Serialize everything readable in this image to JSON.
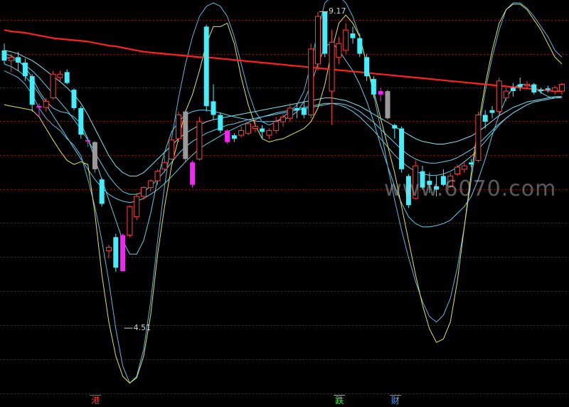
{
  "chart_data": {
    "type": "candlestick",
    "ylim": [
      3.6,
      9.3
    ],
    "grid": true,
    "annotations": {
      "high": "9.17",
      "low": "4.51"
    },
    "markers": [
      {
        "label": "港",
        "index": 13,
        "color": "#ff3030"
      },
      {
        "label": "跌",
        "index": 48,
        "color": "#20ff40"
      },
      {
        "label": "财",
        "index": 56,
        "color": "#4aa8ff"
      }
    ],
    "watermark": "www.6070.com",
    "candles": [
      [
        8.6,
        8.7,
        8.4,
        8.45,
        "down"
      ],
      [
        8.45,
        8.55,
        8.28,
        8.5,
        "up"
      ],
      [
        8.5,
        8.58,
        8.3,
        8.42,
        "down"
      ],
      [
        8.42,
        8.48,
        8.15,
        8.22,
        "down"
      ],
      [
        8.22,
        8.25,
        7.7,
        7.8,
        "down"
      ],
      [
        7.78,
        7.82,
        7.62,
        7.76,
        "doji"
      ],
      [
        7.76,
        7.9,
        7.7,
        7.85,
        "up"
      ],
      [
        7.9,
        8.3,
        7.88,
        8.25,
        "up"
      ],
      [
        8.2,
        8.3,
        8.15,
        8.25,
        "up"
      ],
      [
        8.28,
        8.32,
        8.1,
        8.12,
        "down"
      ],
      [
        8.02,
        8.04,
        7.72,
        7.75,
        "down"
      ],
      [
        7.75,
        7.78,
        7.3,
        7.36,
        "down"
      ],
      [
        7.28,
        7.32,
        7.18,
        7.26,
        "doji"
      ],
      [
        7.25,
        7.26,
        6.8,
        6.85,
        "gray"
      ],
      [
        6.7,
        6.72,
        6.3,
        6.34,
        "down"
      ],
      [
        5.7,
        5.74,
        5.54,
        5.65,
        "up"
      ],
      [
        5.85,
        5.9,
        5.34,
        5.4,
        "down"
      ],
      [
        5.88,
        5.9,
        5.35,
        5.35,
        "doji"
      ],
      [
        5.88,
        6.32,
        5.85,
        6.3,
        "up"
      ],
      [
        6.15,
        6.5,
        6.1,
        6.45,
        "up"
      ],
      [
        6.45,
        6.6,
        6.4,
        6.58,
        "up"
      ],
      [
        6.58,
        6.7,
        6.52,
        6.68,
        "up"
      ],
      [
        6.68,
        6.85,
        6.62,
        6.82,
        "up"
      ],
      [
        6.85,
        7.05,
        6.8,
        6.95,
        "up"
      ],
      [
        7.0,
        7.32,
        6.98,
        7.28,
        "up"
      ],
      [
        7.3,
        7.7,
        7.25,
        7.65,
        "up"
      ],
      [
        7.7,
        7.72,
        6.95,
        7.0,
        "gray"
      ],
      [
        6.95,
        6.98,
        6.58,
        6.62,
        "doji"
      ],
      [
        7.0,
        7.62,
        6.98,
        7.55,
        "up"
      ],
      [
        8.95,
        8.98,
        7.7,
        7.78,
        "down"
      ],
      [
        7.85,
        8.1,
        7.58,
        7.65,
        "down"
      ],
      [
        7.65,
        7.68,
        7.38,
        7.42,
        "down"
      ],
      [
        7.42,
        7.44,
        7.22,
        7.25,
        "doji"
      ],
      [
        7.3,
        7.38,
        7.25,
        7.35,
        "down"
      ],
      [
        7.35,
        7.48,
        7.32,
        7.42,
        "up"
      ],
      [
        7.38,
        7.55,
        7.35,
        7.52,
        "up"
      ],
      [
        7.48,
        7.58,
        7.4,
        7.45,
        "up"
      ],
      [
        7.45,
        7.5,
        7.3,
        7.4,
        "down"
      ],
      [
        7.35,
        7.45,
        7.3,
        7.42,
        "up"
      ],
      [
        7.42,
        7.62,
        7.38,
        7.55,
        "up"
      ],
      [
        7.55,
        7.66,
        7.48,
        7.62,
        "up"
      ],
      [
        7.6,
        7.82,
        7.55,
        7.75,
        "up"
      ],
      [
        7.72,
        7.82,
        7.6,
        7.75,
        "doji"
      ],
      [
        7.75,
        7.85,
        7.6,
        7.65,
        "down"
      ],
      [
        7.65,
        8.7,
        7.6,
        8.62,
        "up"
      ],
      [
        8.4,
        9.17,
        8.3,
        9.1,
        "up"
      ],
      [
        9.17,
        9.17,
        8.5,
        8.55,
        "down"
      ],
      [
        8.0,
        8.9,
        7.5,
        8.72,
        "up"
      ],
      [
        8.5,
        8.8,
        8.4,
        8.7,
        "up"
      ],
      [
        8.6,
        9.0,
        8.55,
        8.9,
        "up"
      ],
      [
        8.85,
        8.95,
        8.7,
        8.78,
        "down"
      ],
      [
        8.78,
        8.85,
        8.5,
        8.55,
        "down"
      ],
      [
        8.5,
        8.55,
        8.15,
        8.22,
        "down"
      ],
      [
        8.18,
        8.22,
        7.9,
        7.95,
        "down"
      ],
      [
        7.95,
        8.05,
        7.85,
        8.0,
        "doji"
      ],
      [
        8.0,
        8.02,
        7.58,
        7.6,
        "gray"
      ],
      [
        7.45,
        7.52,
        7.3,
        7.5,
        "down"
      ],
      [
        7.45,
        7.48,
        6.8,
        6.85,
        "down"
      ],
      [
        6.75,
        6.78,
        6.28,
        6.32,
        "down"
      ],
      [
        6.42,
        6.98,
        6.4,
        6.9,
        "up"
      ],
      [
        6.58,
        6.9,
        6.55,
        6.82,
        "doji"
      ],
      [
        6.68,
        6.8,
        6.5,
        6.62,
        "down"
      ],
      [
        6.6,
        6.75,
        6.45,
        6.55,
        "doji"
      ],
      [
        6.62,
        6.85,
        6.6,
        6.75,
        "down"
      ],
      [
        6.6,
        6.8,
        6.58,
        6.75,
        "up"
      ],
      [
        6.78,
        6.92,
        6.75,
        6.88,
        "up"
      ],
      [
        6.85,
        6.95,
        6.8,
        6.9,
        "up"
      ],
      [
        6.92,
        7.0,
        6.88,
        6.95,
        "doji"
      ],
      [
        6.98,
        7.7,
        6.95,
        7.65,
        "up"
      ],
      [
        7.65,
        7.72,
        7.45,
        7.55,
        "down"
      ],
      [
        7.68,
        7.78,
        7.6,
        7.72,
        "down"
      ],
      [
        7.7,
        8.2,
        7.65,
        8.15,
        "up"
      ],
      [
        7.9,
        8.05,
        7.85,
        8.0,
        "up"
      ],
      [
        8.0,
        8.12,
        7.92,
        8.05,
        "down"
      ],
      [
        8.1,
        8.2,
        8.0,
        8.06,
        "down"
      ],
      [
        8.08,
        8.15,
        8.04,
        8.1,
        "up"
      ],
      [
        8.1,
        8.12,
        7.95,
        7.98,
        "down"
      ],
      [
        8.0,
        8.05,
        7.96,
        8.02,
        "down"
      ],
      [
        8.02,
        8.08,
        7.98,
        8.04,
        "doji"
      ],
      [
        8.05,
        8.08,
        7.95,
        8.0,
        "up"
      ],
      [
        8.0,
        8.12,
        7.95,
        8.1,
        "up"
      ]
    ],
    "ma_red": [
      8.9,
      8.88,
      8.87,
      8.86,
      8.84,
      8.82,
      8.8,
      8.78,
      8.77,
      8.76,
      8.75,
      8.74,
      8.73,
      8.71,
      8.69,
      8.67,
      8.66,
      8.64,
      8.62,
      8.6,
      8.58,
      8.57,
      8.56,
      8.55,
      8.54,
      8.53,
      8.52,
      8.51,
      8.5,
      8.5,
      8.49,
      8.48,
      8.47,
      8.46,
      8.45,
      8.44,
      8.43,
      8.42,
      8.41,
      8.4,
      8.39,
      8.38,
      8.37,
      8.36,
      8.35,
      8.34,
      8.33,
      8.32,
      8.31,
      8.3,
      8.29,
      8.28,
      8.27,
      8.26,
      8.25,
      8.24,
      8.23,
      8.22,
      8.21,
      8.2,
      8.19,
      8.18,
      8.17,
      8.16,
      8.15,
      8.14,
      8.13,
      8.12,
      8.11,
      8.1,
      8.09,
      8.08,
      8.07,
      8.06,
      8.05,
      8.04,
      8.03,
      8.02,
      8.01,
      8.0,
      8.0
    ],
    "band_outer": [
      8.55,
      8.52,
      8.45,
      8.35,
      8.2,
      8.0,
      7.85,
      7.75,
      7.7,
      7.68,
      7.62,
      7.52,
      7.3,
      7.0,
      6.7,
      6.4,
      6.1,
      5.8,
      5.6,
      5.6,
      5.8,
      6.2,
      6.7,
      7.1,
      7.4,
      7.55,
      7.65,
      7.7,
      7.72,
      7.72,
      7.7,
      7.68,
      7.65,
      7.62,
      7.6,
      7.58,
      7.56,
      7.55,
      7.55,
      7.56,
      7.58,
      7.62,
      7.7,
      7.85,
      8.1,
      8.4,
      8.65,
      8.72,
      8.6,
      8.45,
      8.3,
      8.1,
      7.85,
      7.55,
      7.2,
      6.9,
      6.6,
      6.35,
      6.15,
      6.05,
      6.0,
      6.0,
      6.02,
      6.05,
      6.1,
      6.2,
      6.3,
      6.45,
      6.7,
      7.0,
      7.35,
      7.65,
      7.9,
      8.05,
      8.1,
      8.1,
      8.05,
      7.98,
      7.92,
      7.9,
      7.9
    ],
    "band_mid_upper": [
      8.6,
      8.58,
      8.55,
      8.5,
      8.45,
      8.38,
      8.3,
      8.22,
      8.14,
      8.05,
      7.95,
      7.82,
      7.65,
      7.45,
      7.25,
      7.05,
      6.9,
      6.8,
      6.75,
      6.75,
      6.8,
      6.9,
      7.0,
      7.1,
      7.2,
      7.3,
      7.38,
      7.44,
      7.5,
      7.55,
      7.58,
      7.6,
      7.62,
      7.64,
      7.66,
      7.68,
      7.7,
      7.72,
      7.74,
      7.76,
      7.78,
      7.8,
      7.82,
      7.84,
      7.86,
      7.88,
      7.9,
      7.9,
      7.88,
      7.86,
      7.82,
      7.78,
      7.72,
      7.66,
      7.6,
      7.54,
      7.48,
      7.42,
      7.36,
      7.3,
      7.26,
      7.24,
      7.22,
      7.22,
      7.24,
      7.26,
      7.3,
      7.34,
      7.4,
      7.48,
      7.56,
      7.64,
      7.7,
      7.76,
      7.8,
      7.84,
      7.86,
      7.88,
      7.9,
      7.92,
      7.92
    ],
    "band_mid_lower": [
      8.5,
      8.48,
      8.44,
      8.38,
      8.3,
      8.2,
      8.08,
      7.96,
      7.84,
      7.72,
      7.58,
      7.44,
      7.28,
      7.1,
      6.92,
      6.75,
      6.62,
      6.52,
      6.48,
      6.48,
      6.52,
      6.6,
      6.7,
      6.82,
      6.95,
      7.08,
      7.18,
      7.26,
      7.32,
      7.38,
      7.42,
      7.46,
      7.5,
      7.52,
      7.55,
      7.58,
      7.6,
      7.62,
      7.64,
      7.66,
      7.68,
      7.7,
      7.72,
      7.74,
      7.76,
      7.78,
      7.8,
      7.82,
      7.82,
      7.8,
      7.76,
      7.7,
      7.62,
      7.54,
      7.44,
      7.34,
      7.24,
      7.14,
      7.06,
      7.0,
      6.96,
      6.94,
      6.94,
      6.96,
      6.98,
      7.02,
      7.08,
      7.14,
      7.22,
      7.32,
      7.42,
      7.52,
      7.6,
      7.68,
      7.74,
      7.8,
      7.84,
      7.86,
      7.88,
      7.9,
      7.92
    ],
    "band_inner": [
      8.4,
      8.36,
      8.3,
      8.22,
      8.1,
      7.96,
      7.8,
      7.64,
      7.48,
      7.32,
      7.16,
      7.0,
      6.85,
      6.7,
      6.58,
      6.48,
      6.42,
      6.38,
      6.36,
      6.38,
      6.42,
      6.48,
      6.55,
      6.64,
      6.74,
      6.85,
      6.96,
      7.06,
      7.15,
      7.22,
      7.28,
      7.34,
      7.4,
      7.45,
      7.5,
      7.54,
      7.58,
      7.62,
      7.65,
      7.68,
      7.7,
      7.72,
      7.74,
      7.76,
      7.78,
      7.8,
      7.82,
      7.82,
      7.8,
      7.76,
      7.7,
      7.62,
      7.52,
      7.42,
      7.3,
      7.18,
      7.06,
      6.96,
      6.88,
      6.82,
      6.78,
      6.76,
      6.76,
      6.78,
      6.82,
      6.88,
      6.96,
      7.04,
      7.14,
      7.26,
      7.38,
      7.5,
      7.6,
      7.68,
      7.74,
      7.8,
      7.84,
      7.86,
      7.88,
      7.9,
      7.92
    ],
    "yellow": [
      7.8,
      7.78,
      7.76,
      7.74,
      7.72,
      7.62,
      7.45,
      7.28,
      7.12,
      6.98,
      6.92,
      6.96,
      6.92,
      6.2,
      5.3,
      4.6,
      4.1,
      3.8,
      3.7,
      3.78,
      4.1,
      4.7,
      5.6,
      6.3,
      6.9,
      7.3,
      7.7,
      7.95,
      8.3,
      8.7,
      8.95,
      8.95,
      9.0,
      8.7,
      8.2,
      7.8,
      7.5,
      7.3,
      7.25,
      7.28,
      7.3,
      7.35,
      7.4,
      7.45,
      7.55,
      7.75,
      8.1,
      8.6,
      9.0,
      9.12,
      9.0,
      8.8,
      8.4,
      8.0,
      7.6,
      7.2,
      6.8,
      6.3,
      5.8,
      5.3,
      4.85,
      4.5,
      4.3,
      4.35,
      4.6,
      5.2,
      6.0,
      6.8,
      7.5,
      8.1,
      8.6,
      9.0,
      9.2,
      9.28,
      9.28,
      9.2,
      9.05,
      8.9,
      8.7,
      8.5,
      8.4
    ],
    "cyan_outer": [
      8.3,
      8.25,
      8.2,
      8.1,
      7.95,
      7.75,
      7.6,
      7.5,
      7.42,
      7.3,
      7.2,
      7.05,
      6.7,
      6.3,
      5.8,
      5.2,
      4.5,
      3.95,
      3.7,
      3.8,
      4.2,
      4.9,
      5.8,
      6.6,
      7.3,
      7.9,
      8.4,
      8.8,
      9.1,
      9.25,
      9.3,
      9.25,
      9.1,
      8.8,
      8.4,
      8.0,
      7.7,
      7.55,
      7.5,
      7.55,
      7.62,
      7.7,
      7.8,
      8.0,
      8.4,
      8.9,
      9.3,
      9.4,
      9.4,
      9.3,
      9.1,
      8.8,
      8.4,
      7.95,
      7.45,
      6.9,
      6.4,
      5.95,
      5.55,
      5.2,
      4.9,
      4.68,
      4.6,
      4.7,
      4.95,
      5.4,
      6.0,
      6.7,
      7.4,
      8.0,
      8.5,
      8.9,
      9.2,
      9.3,
      9.3,
      9.22,
      9.1,
      8.95,
      8.8,
      8.6,
      8.5
    ]
  }
}
